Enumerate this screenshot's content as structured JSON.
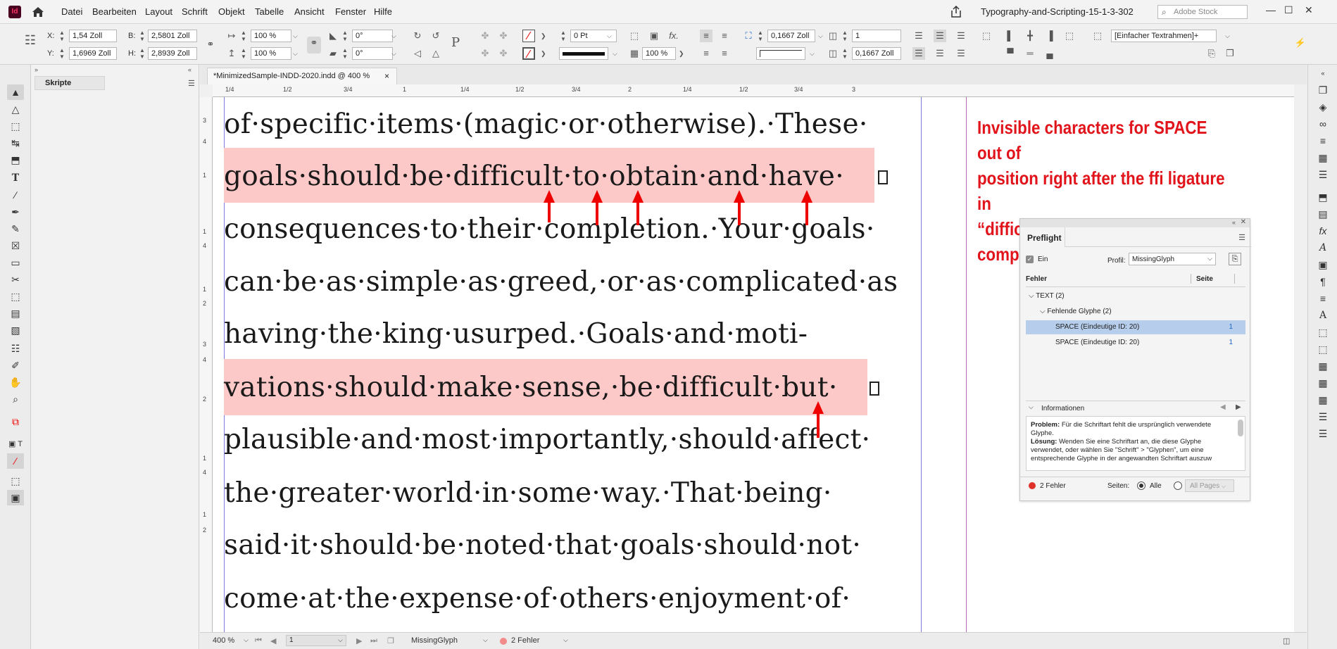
{
  "app": {
    "logo": "Id",
    "doc_title": "Typography-and-Scripting-15-1-3-302",
    "stock_placeholder": "Adobe Stock"
  },
  "menu": [
    "Datei",
    "Bearbeiten",
    "Layout",
    "Schrift",
    "Objekt",
    "Tabelle",
    "Ansicht",
    "Fenster",
    "Hilfe"
  ],
  "window_controls": [
    "—",
    "☐",
    "✕"
  ],
  "controlbar": {
    "x_label": "X:",
    "x_value": "1,54 Zoll",
    "y_label": "Y:",
    "y_value": "1,6969 Zoll",
    "w_label": "B:",
    "w_value": "2,5801 Zoll",
    "h_label": "H:",
    "h_value": "2,8939 Zoll",
    "scale_x": "100 %",
    "scale_y": "100 %",
    "rotate": "0°",
    "shear": "0°",
    "stroke_weight": "0 Pt",
    "opacity": "100 %",
    "corner_size": "0,1667 Zoll",
    "columns": "1",
    "gutter": "0,1667 Zoll",
    "style": "[Einfacher Textrahmen]+",
    "p_icon": "P",
    "fx_icon": "fx."
  },
  "scripts_panel": {
    "title": "Skripte"
  },
  "doc_tab": {
    "label": "*MinimizedSample-INDD-2020.indd @ 400 %",
    "close": "×"
  },
  "ruler": {
    "top": [
      "1/4",
      "1/2",
      "3/4",
      "1",
      "1/4",
      "1/2",
      "3/4",
      "2",
      "1/4",
      "1/2",
      "3/4",
      "3"
    ],
    "left": [
      "3",
      "4",
      "1",
      "1",
      "4",
      "1",
      "2",
      "3",
      "4",
      "2",
      "1",
      "4",
      "1",
      "2"
    ]
  },
  "text_lines": [
    "of·specific·items·(magic·or·otherwise).·These·",
    "goals·should·be·difficult·to·obtain·and·have·",
    "consequences·to·their·completion.·Your·goals·",
    "can·be·as·simple·as·greed,·or·as·complicated·as",
    "having·the·king·usurped.·Goals·and·moti-",
    "vations·should·make·sense,·be·difficult·but·",
    "plausible·and·most·importantly,·should·affect·",
    "the·greater·world·in·some·way.·That·being·",
    "said·it·should·be·noted·that·goals·should·not·",
    "come·at·the·expense·of·others·enjoyment·of·"
  ],
  "annotation": {
    "line1": "Invisible characters for SPACE out of",
    "line2": "position right after the ffi ligature in",
    "line3": "“difficult”. A bug of the composer?"
  },
  "preflight": {
    "title": "Preflight",
    "on_label": "Ein",
    "profile_label": "Profil:",
    "profile_value": "MissingGlyph",
    "col_error": "Fehler",
    "col_page": "Seite",
    "tree": [
      {
        "label": "TEXT (2)",
        "page": ""
      },
      {
        "label": "Fehlende Glyphe (2)",
        "page": ""
      },
      {
        "label": "SPACE (Eindeutige ID: 20)",
        "page": "1"
      },
      {
        "label": "SPACE (Eindeutige ID: 20)",
        "page": "1"
      }
    ],
    "info_label": "Informationen",
    "problem_label": "Problem:",
    "problem_text": "Für die Schriftart fehlt die ursprünglich verwendete Glyphe.",
    "solution_label": "Lösung:",
    "solution_text": "Wenden Sie eine Schriftart an, die diese Glyphe verwendet, oder wählen Sie \"Schrift\" > \"Glyphen\", um eine entsprechende Glyphe in der angewandten Schriftart auszuw",
    "error_count": "2 Fehler",
    "pages_label": "Seiten:",
    "pages_all": "Alle",
    "pages_all_pages": "All Pages",
    "status_color": "#e0302a"
  },
  "statusbar": {
    "zoom": "400 %",
    "page": "1",
    "profile": "MissingGlyph",
    "errors": "2 Fehler"
  },
  "colors": {
    "highlight": "#fcc8c8",
    "annotation": "#e2141b",
    "guide": "#7b7be0",
    "selected_row": "#b6cdeb"
  }
}
